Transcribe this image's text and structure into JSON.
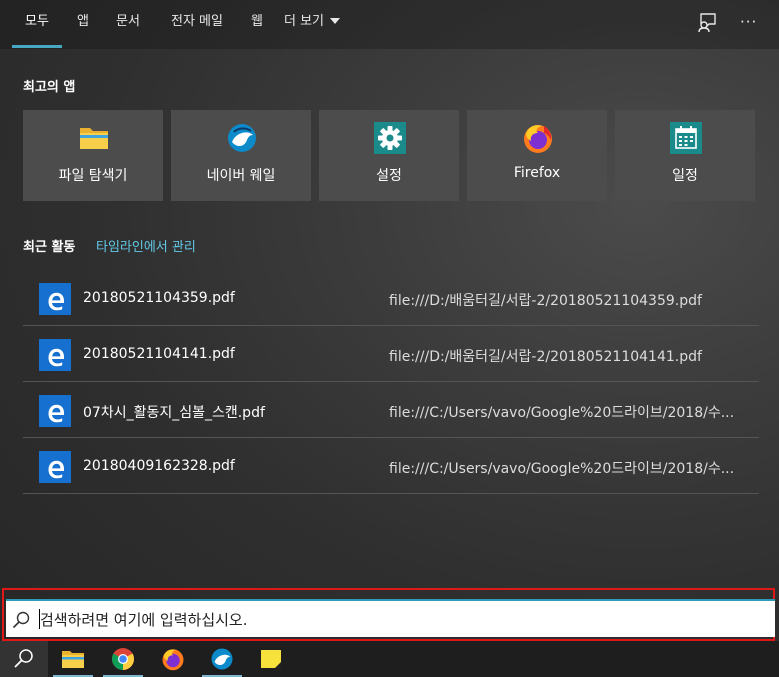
{
  "nav": {
    "tabs": [
      {
        "label": "모두"
      },
      {
        "label": "앱"
      },
      {
        "label": "문서"
      },
      {
        "label": "전자 메일"
      },
      {
        "label": "웹"
      },
      {
        "label": "더 보기"
      }
    ],
    "active_tab": "모두"
  },
  "top_apps": {
    "title": "최고의 앱",
    "items": [
      {
        "label": "파일 탐색기",
        "icon": "file-explorer-icon"
      },
      {
        "label": "네이버 웨일",
        "icon": "naver-whale-icon"
      },
      {
        "label": "설정",
        "icon": "settings-gear-icon"
      },
      {
        "label": "Firefox",
        "icon": "firefox-icon"
      },
      {
        "label": "일정",
        "icon": "calendar-icon"
      }
    ]
  },
  "recent": {
    "title": "최근 활동",
    "timeline_link": "타임라인에서 관리",
    "items": [
      {
        "name": "20180521104359.pdf",
        "path": "file:///D:/배움터길/서랍-2/20180521104359.pdf",
        "icon": "edge-icon"
      },
      {
        "name": "20180521104141.pdf",
        "path": "file:///D:/배움터길/서랍-2/20180521104141.pdf",
        "icon": "edge-icon"
      },
      {
        "name": "07차시_활동지_심볼_스캔.pdf",
        "path": "file:///C:/Users/vavo/Google%20드라이브/2018/수...",
        "icon": "edge-icon"
      },
      {
        "name": "20180409162328.pdf",
        "path": "file:///C:/Users/vavo/Google%20드라이브/2018/수...",
        "icon": "edge-icon"
      }
    ]
  },
  "search": {
    "placeholder": "검색하려면 여기에 입력하십시오."
  },
  "taskbar": {
    "items": [
      "search-icon",
      "file-explorer-icon",
      "chrome-icon",
      "firefox-icon",
      "naver-whale-icon",
      "sticky-notes-icon"
    ]
  },
  "colors": {
    "accent": "#46a8c2",
    "link": "#61c8e6",
    "tile": "#4c4c4c",
    "highlight_frame": "#e01818"
  }
}
